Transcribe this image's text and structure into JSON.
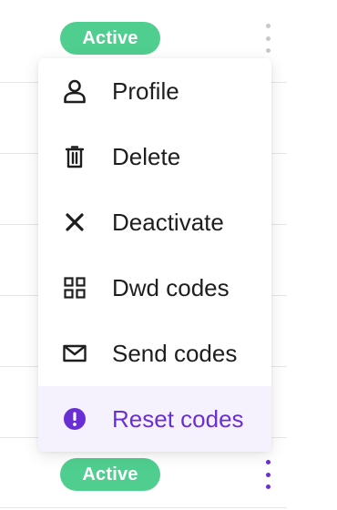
{
  "colors": {
    "badge_green": "#4fce8f",
    "kebab_gray": "#c8c8c8",
    "kebab_purple": "#6a2fd4",
    "accent_purple": "#6a2fd4",
    "text_dark": "#1e1e1e"
  },
  "rows": [
    {
      "status": "Active",
      "kebab_state": "inactive"
    },
    {
      "status": "Active",
      "kebab_state": "active"
    }
  ],
  "menu": {
    "items": [
      {
        "label": "Profile",
        "icon": "user-icon"
      },
      {
        "label": "Delete",
        "icon": "trash-icon"
      },
      {
        "label": "Deactivate",
        "icon": "close-icon"
      },
      {
        "label": "Dwd codes",
        "icon": "grid-icon"
      },
      {
        "label": "Send codes",
        "icon": "envelope-icon"
      },
      {
        "label": "Reset codes",
        "icon": "alert-circle-icon",
        "highlighted": true
      }
    ]
  }
}
